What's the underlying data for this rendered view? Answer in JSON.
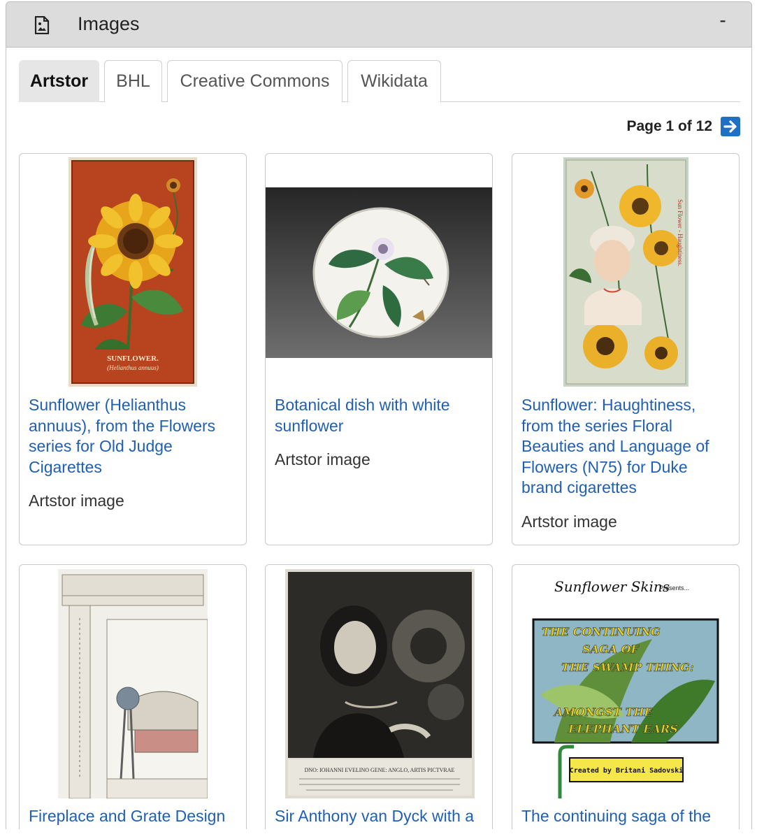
{
  "header": {
    "title": "Images",
    "collapse_label": "-",
    "icon": "image-file-icon"
  },
  "tabs": [
    {
      "label": "Artstor",
      "active": true
    },
    {
      "label": "BHL",
      "active": false
    },
    {
      "label": "Creative Commons",
      "active": false
    },
    {
      "label": "Wikidata",
      "active": false
    }
  ],
  "pager": {
    "label": "Page 1 of 12",
    "next_icon": "arrow-right-icon"
  },
  "cards": [
    {
      "title": "Sunflower (Helianthus annuus), from the Flowers series for Old Judge Cigarettes",
      "source": "Artstor image",
      "thumb_text": "SUNFLOWER.",
      "thumb_subtext": "(Helianthus annuus)"
    },
    {
      "title": "Botanical dish with white sunflower",
      "source": "Artstor image"
    },
    {
      "title": "Sunflower: Haughtiness, from the series Floral Beauties and Language of Flowers (N75) for Duke brand cigarettes",
      "source": "Artstor image",
      "thumb_text": "Sun Flower - Haughtiness."
    },
    {
      "title": "Fireplace and Grate Design",
      "source": ""
    },
    {
      "title": "Sir Anthony van Dyck with a",
      "source": "",
      "thumb_text": "DNO: IOHANNI EVELINO GENE: ANGLO, ARTIS PICTVRAE"
    },
    {
      "title": "The continuing saga of the",
      "source": "",
      "thumb_script": "Sunflower Skins",
      "thumb_presents": "Presents...",
      "thumb_lines": [
        "THE CONTINUING",
        "SAGA OF",
        "THE SWAMP THING:",
        "AMONGST THE",
        "ELEPHANT EARS"
      ],
      "thumb_credit": "Created by Britani Sadovski"
    }
  ]
}
